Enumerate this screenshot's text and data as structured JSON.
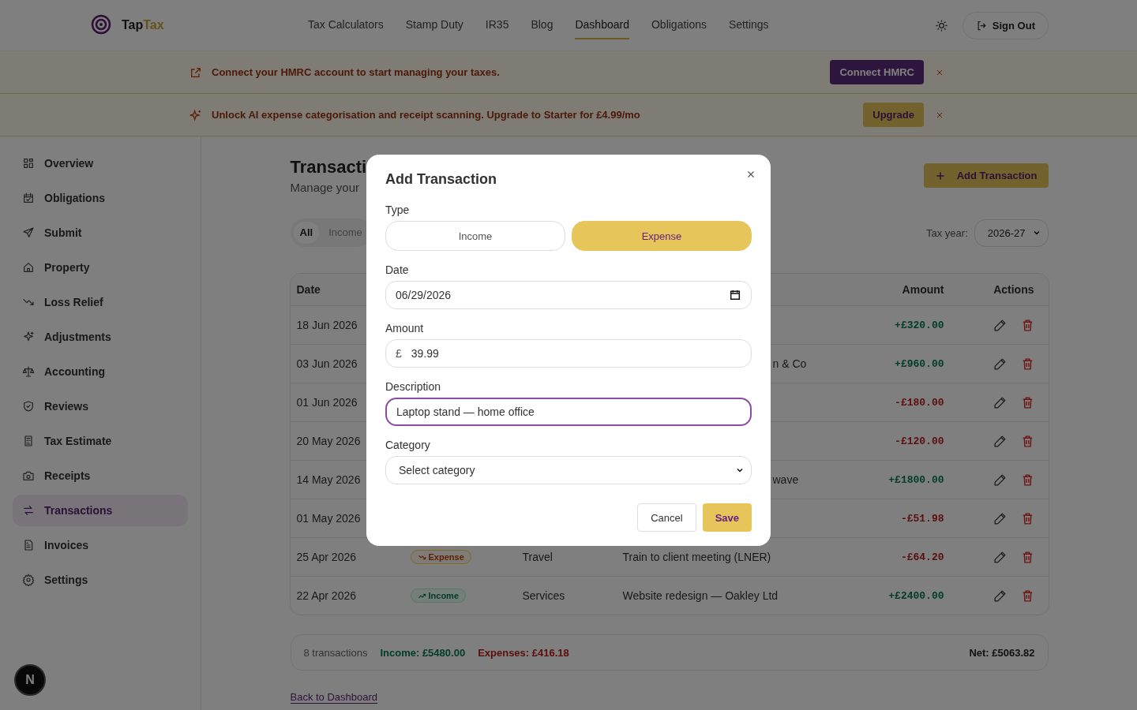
{
  "nav": {
    "logo_main": "Tap",
    "logo_accent": "Tax",
    "links": [
      {
        "label": "Tax Calculators",
        "selected": false
      },
      {
        "label": "Stamp Duty",
        "selected": false
      },
      {
        "label": "IR35",
        "selected": false
      },
      {
        "label": "Blog",
        "selected": false
      },
      {
        "label": "Dashboard",
        "selected": true
      },
      {
        "label": "Obligations",
        "selected": false
      },
      {
        "label": "Settings",
        "selected": false
      }
    ],
    "sign_out": "Sign Out"
  },
  "banners": [
    {
      "kind": "hmrc",
      "text": "Connect your HMRC account to start managing your taxes.",
      "button": "Connect HMRC"
    },
    {
      "kind": "upgrade",
      "text": "Unlock AI expense categorisation and receipt scanning. Upgrade to Starter for £4.99/mo",
      "button": "Upgrade"
    }
  ],
  "sidebar": {
    "items": [
      {
        "label": "Overview",
        "selected": false
      },
      {
        "label": "Obligations",
        "selected": false
      },
      {
        "label": "Submit",
        "selected": false
      },
      {
        "label": "Property",
        "selected": false
      },
      {
        "label": "Loss Relief",
        "selected": false
      },
      {
        "label": "Adjustments",
        "selected": false
      },
      {
        "label": "Accounting",
        "selected": false
      },
      {
        "label": "Reviews",
        "selected": false
      },
      {
        "label": "Tax Estimate",
        "selected": false
      },
      {
        "label": "Receipts",
        "selected": false
      },
      {
        "label": "Transactions",
        "selected": true
      },
      {
        "label": "Invoices",
        "selected": false
      },
      {
        "label": "Settings",
        "selected": false
      }
    ],
    "dev_badge": "N"
  },
  "page": {
    "title": "Transacti",
    "subtitle": "Manage your",
    "add_button": "Add Transaction",
    "filters": [
      {
        "label": "All",
        "selected": true
      },
      {
        "label": "Income",
        "selected": false
      }
    ],
    "tax_year_label": "Tax year:",
    "tax_year": "2026-27"
  },
  "table": {
    "date_header": "Date",
    "amount_header": "Amount",
    "actions_header": "Actions",
    "rows": [
      {
        "date": "18 Jun 2026",
        "amount": "+£320.00",
        "kind": "income"
      },
      {
        "date": "03 Jun 2026",
        "description_tail": "n & Co",
        "amount": "+£960.00",
        "kind": "income"
      },
      {
        "date": "01 Jun 2026",
        "amount": "-£180.00",
        "kind": "expense"
      },
      {
        "date": "20 May 2026",
        "amount": "-£120.00",
        "kind": "expense"
      },
      {
        "date": "14 May 2026",
        "description_tail": "wave",
        "amount": "+£1800.00",
        "kind": "income"
      },
      {
        "date": "01 May 2026",
        "amount": "-£51.98",
        "kind": "expense"
      },
      {
        "date": "25 Apr 2026",
        "badge": "Expense",
        "category": "Travel",
        "description": "Train to client meeting (LNER)",
        "amount": "-£64.20",
        "kind": "expense"
      },
      {
        "date": "22 Apr 2026",
        "badge": "Income",
        "category": "Services",
        "description": "Website redesign — Oakley Ltd",
        "amount": "+£2400.00",
        "kind": "income"
      }
    ]
  },
  "summary": {
    "count": "8 transactions",
    "income": "Income: £5480.00",
    "expenses": "Expenses: £416.18",
    "net": "Net: £5063.82"
  },
  "back_link": "Back to Dashboard",
  "modal": {
    "title": "Add Transaction",
    "type_label": "Type",
    "type_options": [
      {
        "label": "Income",
        "selected": false
      },
      {
        "label": "Expense",
        "selected": true
      }
    ],
    "date_label": "Date",
    "date_value": "06/29/2026",
    "amount_label": "Amount",
    "currency": "£",
    "amount_value": "39.99",
    "description_label": "Description",
    "description_value": "Laptop stand — home office",
    "description_focused": true,
    "category_label": "Category",
    "category_placeholder": "Select category",
    "cancel": "Cancel",
    "save": "Save"
  }
}
